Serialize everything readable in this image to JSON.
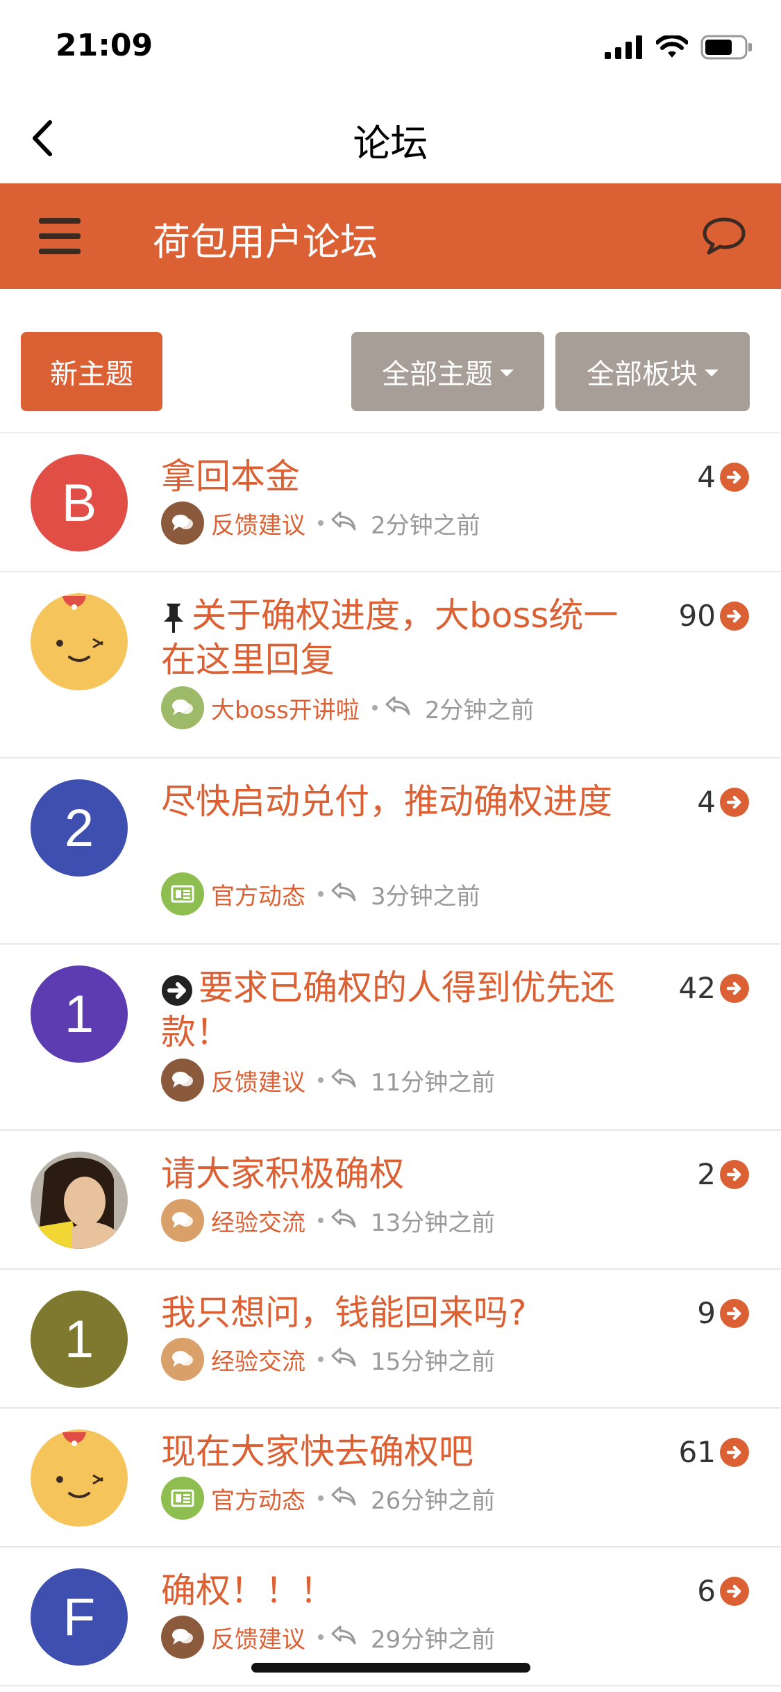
{
  "status_bar": {
    "time": "21:09"
  },
  "nav": {
    "title": "论坛"
  },
  "forum": {
    "title": "荷包用户论坛"
  },
  "controls": {
    "new_topic": "新主题",
    "filter_topics": "全部主题",
    "filter_boards": "全部板块"
  },
  "colors": {
    "accent": "#DB6134",
    "filter_bg": "#A79F97"
  },
  "topics": [
    {
      "title": "拿回本金",
      "category": "反馈建议",
      "time": "2分钟之前",
      "count": "4",
      "avatar_letter": "B",
      "avatar_color": "#E04E45",
      "cat_color": "#8B5A3C",
      "cat_icon": "chat-icon"
    },
    {
      "title": "关于确权进度，大boss统一在这里回复",
      "category": "大boss开讲啦",
      "time": "2分钟之前",
      "count": "90",
      "avatar_letter": "",
      "avatar_color": "#F5C45A",
      "cat_color": "#9DBA68",
      "cat_icon": "chat-icon",
      "pinned": true
    },
    {
      "title": "尽快启动兑付，推动确权进度",
      "category": "官方动态",
      "time": "3分钟之前",
      "count": "4",
      "avatar_letter": "2",
      "avatar_color": "#3F4FB0",
      "cat_color": "#8DBE4F",
      "cat_icon": "news-icon"
    },
    {
      "title": "要求已确权的人得到优先还款！",
      "category": "反馈建议",
      "time": "11分钟之前",
      "count": "42",
      "avatar_letter": "1",
      "avatar_color": "#5D3BB0",
      "cat_color": "#8B5A3C",
      "cat_icon": "chat-icon",
      "moved": true
    },
    {
      "title": "请大家积极确权",
      "category": "经验交流",
      "time": "13分钟之前",
      "count": "2",
      "avatar_letter": "",
      "avatar_color": "#c9a27a",
      "cat_color": "#D9A06A",
      "cat_icon": "chat-icon"
    },
    {
      "title": "我只想问，钱能回来吗?",
      "category": "经验交流",
      "time": "15分钟之前",
      "count": "9",
      "avatar_letter": "1",
      "avatar_color": "#7E792F",
      "cat_color": "#D9A06A",
      "cat_icon": "chat-icon"
    },
    {
      "title": "现在大家快去确权吧",
      "category": "官方动态",
      "time": "26分钟之前",
      "count": "61",
      "avatar_letter": "",
      "avatar_color": "#F5C45A",
      "cat_color": "#8DBE4F",
      "cat_icon": "news-icon"
    },
    {
      "title": "确权！！！",
      "category": "反馈建议",
      "time": "29分钟之前",
      "count": "6",
      "avatar_letter": "F",
      "avatar_color": "#3F4FB0",
      "cat_color": "#8B5A3C",
      "cat_icon": "chat-icon"
    }
  ]
}
